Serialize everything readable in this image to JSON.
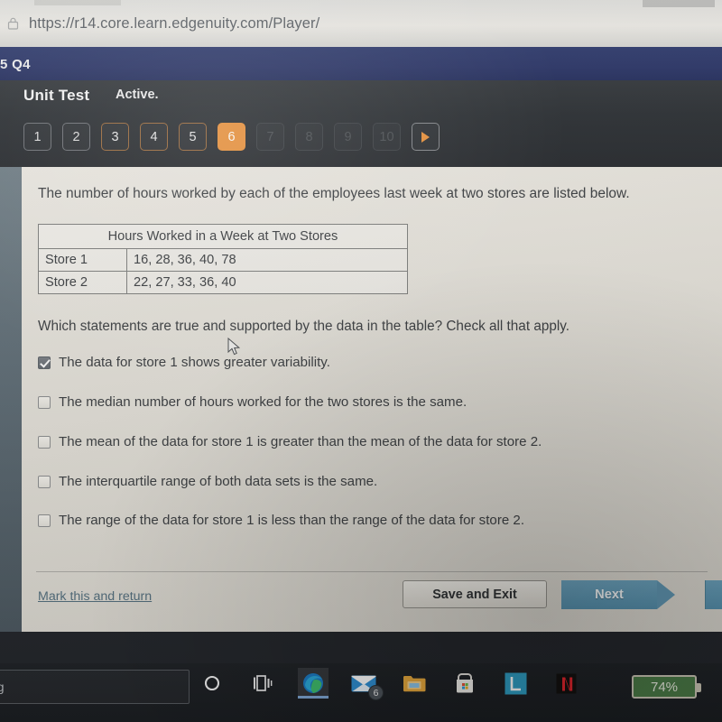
{
  "browser": {
    "url": "https://r14.core.learn.edgenuity.com/Player/",
    "lock_icon": "lock-icon"
  },
  "header": {
    "question_code": "5 Q4",
    "unit_title": "Unit Test",
    "status_label": "Active.",
    "question_numbers": [
      {
        "label": "1",
        "state": "visited"
      },
      {
        "label": "2",
        "state": "visited"
      },
      {
        "label": "3",
        "state": "answered"
      },
      {
        "label": "4",
        "state": "answered"
      },
      {
        "label": "5",
        "state": "answered"
      },
      {
        "label": "6",
        "state": "current"
      },
      {
        "label": "7",
        "state": "dim"
      },
      {
        "label": "8",
        "state": "dim"
      },
      {
        "label": "9",
        "state": "dim"
      },
      {
        "label": "10",
        "state": "dim"
      }
    ],
    "play_button_icon": "play-triangle-icon"
  },
  "question": {
    "stem": "The number of hours worked by each of the employees last week at two stores are listed below.",
    "prompt": "Which statements are true and supported by the data in the table? Check all that apply."
  },
  "table": {
    "caption": "Hours Worked in a Week at Two Stores",
    "rows": [
      {
        "label": "Store 1",
        "values": "16, 28, 36, 40, 78"
      },
      {
        "label": "Store 2",
        "values": "22, 27, 33, 36, 40"
      }
    ]
  },
  "options": [
    {
      "label": "The data for store 1 shows greater variability.",
      "checked": true
    },
    {
      "label": "The median number of hours worked for the two stores is the same.",
      "checked": false
    },
    {
      "label": "The mean of the data for store 1 is greater than the mean of the data for store 2.",
      "checked": false
    },
    {
      "label": "The interquartile range of both data sets is the same.",
      "checked": false
    },
    {
      "label": "The range of the data for store 1 is less than the range of the data for store 2.",
      "checked": false
    }
  ],
  "footer": {
    "mark_link": "Mark this and return",
    "save_label": "Save and Exit",
    "next_label": "Next"
  },
  "taskbar": {
    "search_text": "ng",
    "icons": [
      {
        "name": "cortana-circle-icon"
      },
      {
        "name": "task-view-icon"
      },
      {
        "name": "edge-browser-icon"
      },
      {
        "name": "mail-icon",
        "badge": "6"
      },
      {
        "name": "file-explorer-icon"
      },
      {
        "name": "microsoft-store-icon"
      },
      {
        "name": "lanschool-icon",
        "letter": "L"
      },
      {
        "name": "netflix-icon",
        "letter": "N"
      }
    ],
    "battery_percent": "74%"
  },
  "colors": {
    "accent_orange": "#e8913c",
    "navy": "#2a3465",
    "next_blue": "#5590ad",
    "battery_green": "#4a7a46"
  }
}
